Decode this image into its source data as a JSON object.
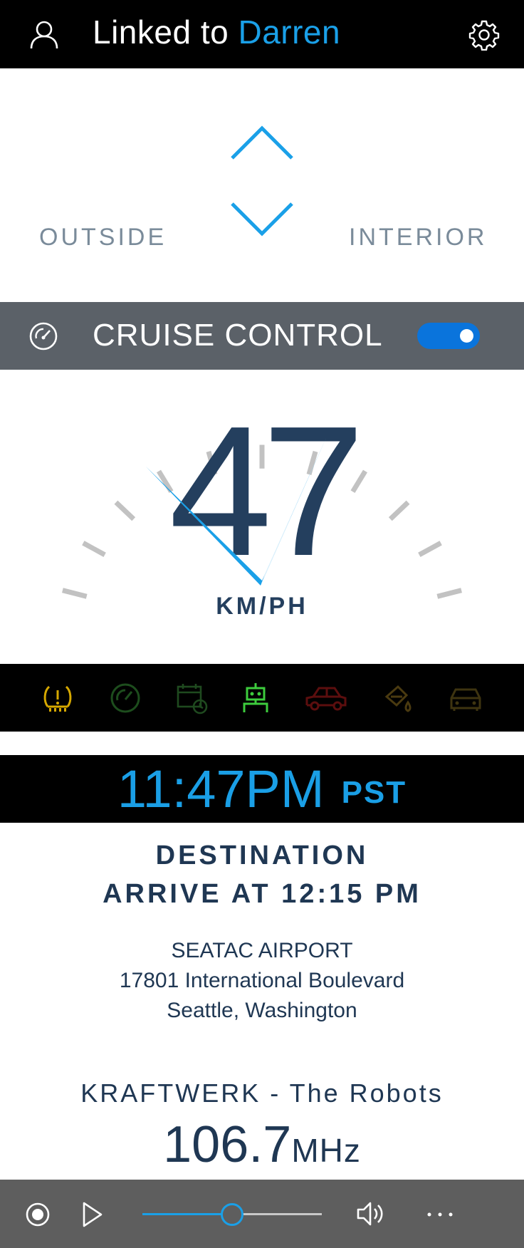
{
  "header": {
    "linked_prefix": "Linked to",
    "linked_name": "Darren",
    "user_icon": "person-icon",
    "settings_icon": "gear-icon"
  },
  "climate": {
    "outside_label": "OUTSIDE",
    "interior_label": "INTERIOR",
    "up_icon": "chevron-up-icon",
    "down_icon": "chevron-down-icon"
  },
  "cruise": {
    "label": "CRUISE CONTROL",
    "icon": "speedometer-icon",
    "enabled": true
  },
  "speed": {
    "value": "47",
    "unit": "KM/PH"
  },
  "status_icons": [
    {
      "name": "tire-pressure-warning-icon",
      "color": "#d6a800"
    },
    {
      "name": "speedometer-icon",
      "color": "#1d4d1d"
    },
    {
      "name": "calendar-clock-icon",
      "color": "#1f4a1f"
    },
    {
      "name": "robot-icon",
      "color": "#3dcc3d"
    },
    {
      "name": "car-side-icon",
      "color": "#5c0e0e"
    },
    {
      "name": "oil-can-icon",
      "color": "#4a3a10"
    },
    {
      "name": "car-front-icon",
      "color": "#3e3410"
    }
  ],
  "time": {
    "clock": "11:47PM",
    "zone": "PST"
  },
  "destination": {
    "heading": "DESTINATION",
    "arrival": "ARRIVE AT 12:15 PM",
    "place": "SEATAC AIRPORT",
    "street": "17801 International Boulevard",
    "city": "Seattle, Washington"
  },
  "radio": {
    "song": "KRAFTWERK - The Robots",
    "frequency": "106.7",
    "band_unit": "MHz"
  },
  "media": {
    "progress": 0.5,
    "record_icon": "record-icon",
    "play_icon": "play-icon",
    "volume_icon": "volume-icon",
    "more_icon": "more-icon"
  },
  "colors": {
    "accent": "#1aa0e8",
    "text_dark": "#1f3753",
    "toggle_on": "#0a74dc"
  }
}
